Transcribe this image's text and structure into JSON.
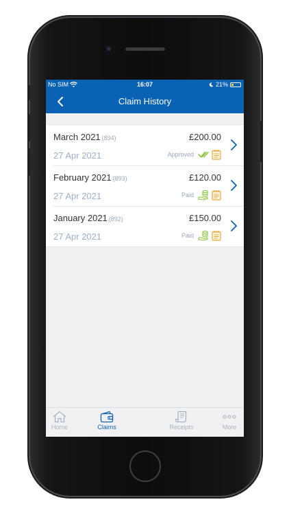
{
  "status_bar": {
    "carrier": "No SIM",
    "time": "16:07",
    "battery": "21%",
    "battery_level": 0.21
  },
  "nav": {
    "title": "Claim History",
    "back_icon": "chevron-left-icon"
  },
  "claims": [
    {
      "month": "March 2021",
      "number": "(894)",
      "date": "27 Apr 2021",
      "amount": "£200.00",
      "status": "Approved",
      "status_icon": "double-check-icon"
    },
    {
      "month": "February 2021",
      "number": "(893)",
      "date": "27 Apr 2021",
      "amount": "£120.00",
      "status": "Paid",
      "status_icon": "coins-hand-icon"
    },
    {
      "month": "January 2021",
      "number": "(892)",
      "date": "27 Apr 2021",
      "amount": "£150.00",
      "status": "Paid",
      "status_icon": "coins-hand-icon"
    }
  ],
  "tabs": [
    {
      "label": "Home",
      "icon": "home-icon",
      "active": false
    },
    {
      "label": "Claims",
      "icon": "wallet-icon",
      "active": true
    },
    {
      "label": "Receipts",
      "icon": "receipt-icon",
      "active": false
    },
    {
      "label": "More",
      "icon": "more-dots-icon",
      "active": false
    }
  ],
  "colors": {
    "primary": "#0a62b5",
    "approved": "#8cc63f",
    "notepad": "#e8a93c",
    "muted_text": "#9db0c8"
  }
}
